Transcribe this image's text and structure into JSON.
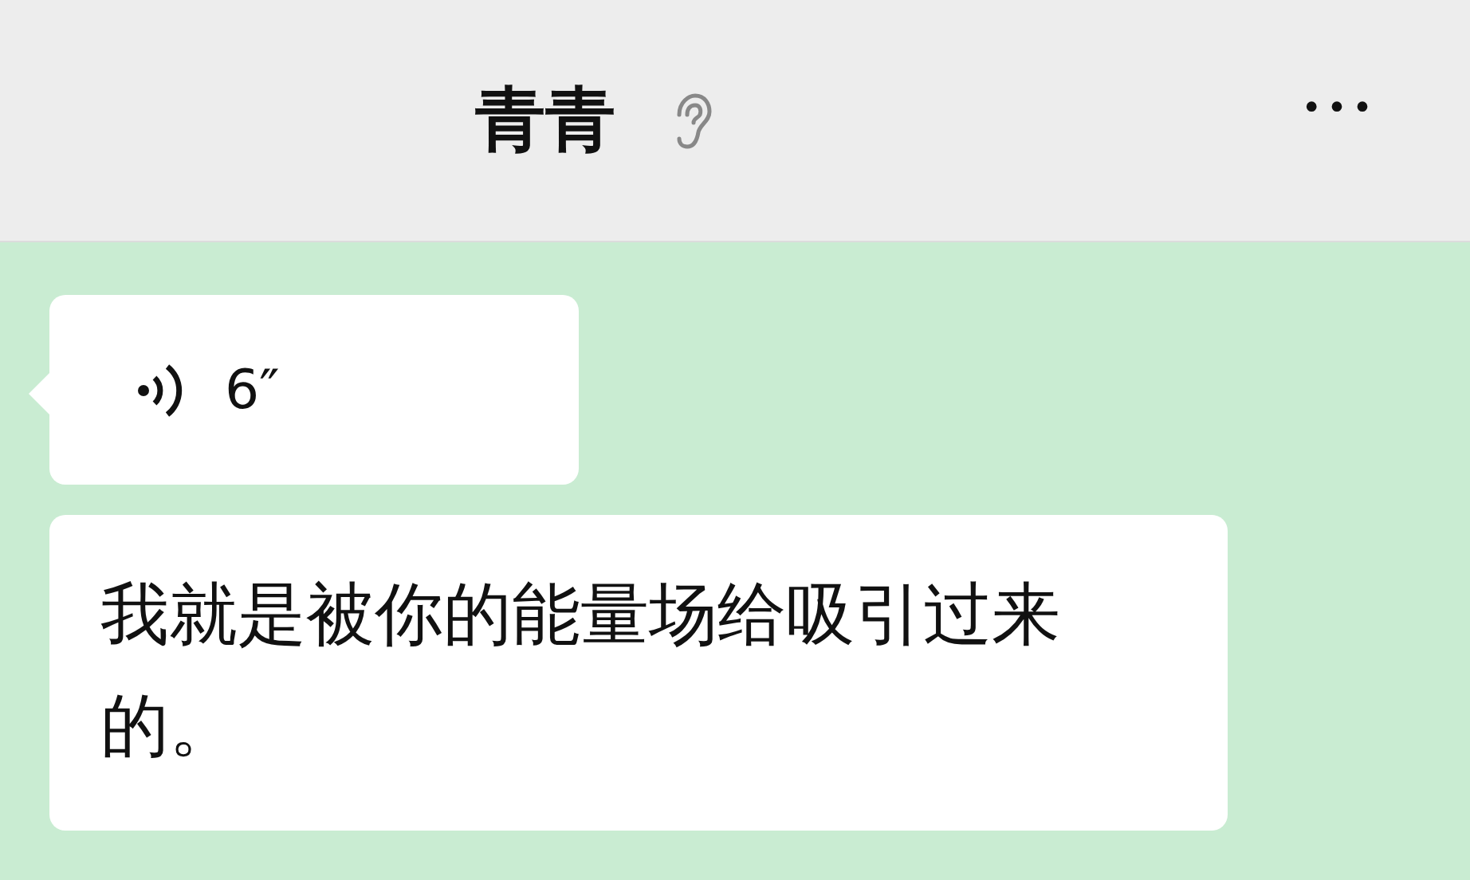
{
  "header": {
    "title": "青青",
    "more": "•••"
  },
  "messages": [
    {
      "kind": "voice",
      "duration": "6″"
    },
    {
      "kind": "text",
      "text": "我就是被你的能量场给吸引过来的。"
    }
  ]
}
